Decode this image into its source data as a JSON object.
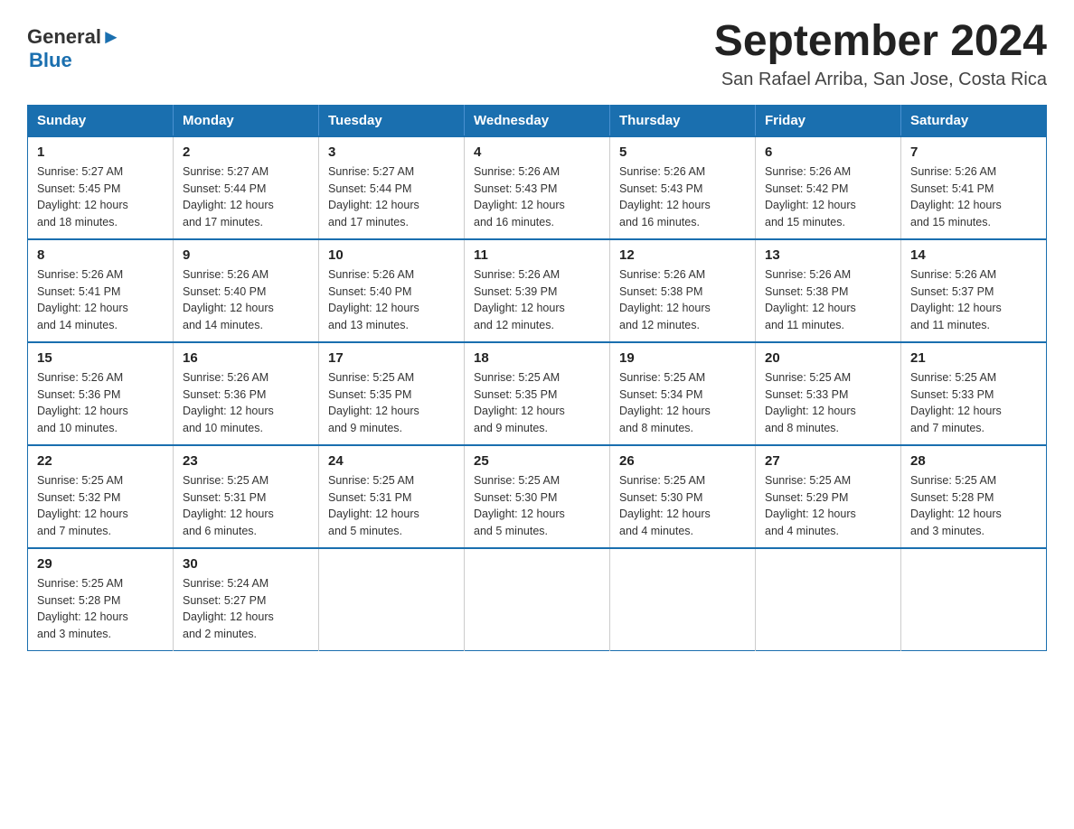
{
  "header": {
    "logo_general": "General",
    "logo_blue": "Blue",
    "month_title": "September 2024",
    "subtitle": "San Rafael Arriba, San Jose, Costa Rica"
  },
  "days_of_week": [
    "Sunday",
    "Monday",
    "Tuesday",
    "Wednesday",
    "Thursday",
    "Friday",
    "Saturday"
  ],
  "weeks": [
    [
      {
        "day": "1",
        "sunrise": "5:27 AM",
        "sunset": "5:45 PM",
        "daylight": "12 hours and 18 minutes."
      },
      {
        "day": "2",
        "sunrise": "5:27 AM",
        "sunset": "5:44 PM",
        "daylight": "12 hours and 17 minutes."
      },
      {
        "day": "3",
        "sunrise": "5:27 AM",
        "sunset": "5:44 PM",
        "daylight": "12 hours and 17 minutes."
      },
      {
        "day": "4",
        "sunrise": "5:26 AM",
        "sunset": "5:43 PM",
        "daylight": "12 hours and 16 minutes."
      },
      {
        "day": "5",
        "sunrise": "5:26 AM",
        "sunset": "5:43 PM",
        "daylight": "12 hours and 16 minutes."
      },
      {
        "day": "6",
        "sunrise": "5:26 AM",
        "sunset": "5:42 PM",
        "daylight": "12 hours and 15 minutes."
      },
      {
        "day": "7",
        "sunrise": "5:26 AM",
        "sunset": "5:41 PM",
        "daylight": "12 hours and 15 minutes."
      }
    ],
    [
      {
        "day": "8",
        "sunrise": "5:26 AM",
        "sunset": "5:41 PM",
        "daylight": "12 hours and 14 minutes."
      },
      {
        "day": "9",
        "sunrise": "5:26 AM",
        "sunset": "5:40 PM",
        "daylight": "12 hours and 14 minutes."
      },
      {
        "day": "10",
        "sunrise": "5:26 AM",
        "sunset": "5:40 PM",
        "daylight": "12 hours and 13 minutes."
      },
      {
        "day": "11",
        "sunrise": "5:26 AM",
        "sunset": "5:39 PM",
        "daylight": "12 hours and 12 minutes."
      },
      {
        "day": "12",
        "sunrise": "5:26 AM",
        "sunset": "5:38 PM",
        "daylight": "12 hours and 12 minutes."
      },
      {
        "day": "13",
        "sunrise": "5:26 AM",
        "sunset": "5:38 PM",
        "daylight": "12 hours and 11 minutes."
      },
      {
        "day": "14",
        "sunrise": "5:26 AM",
        "sunset": "5:37 PM",
        "daylight": "12 hours and 11 minutes."
      }
    ],
    [
      {
        "day": "15",
        "sunrise": "5:26 AM",
        "sunset": "5:36 PM",
        "daylight": "12 hours and 10 minutes."
      },
      {
        "day": "16",
        "sunrise": "5:26 AM",
        "sunset": "5:36 PM",
        "daylight": "12 hours and 10 minutes."
      },
      {
        "day": "17",
        "sunrise": "5:25 AM",
        "sunset": "5:35 PM",
        "daylight": "12 hours and 9 minutes."
      },
      {
        "day": "18",
        "sunrise": "5:25 AM",
        "sunset": "5:35 PM",
        "daylight": "12 hours and 9 minutes."
      },
      {
        "day": "19",
        "sunrise": "5:25 AM",
        "sunset": "5:34 PM",
        "daylight": "12 hours and 8 minutes."
      },
      {
        "day": "20",
        "sunrise": "5:25 AM",
        "sunset": "5:33 PM",
        "daylight": "12 hours and 8 minutes."
      },
      {
        "day": "21",
        "sunrise": "5:25 AM",
        "sunset": "5:33 PM",
        "daylight": "12 hours and 7 minutes."
      }
    ],
    [
      {
        "day": "22",
        "sunrise": "5:25 AM",
        "sunset": "5:32 PM",
        "daylight": "12 hours and 7 minutes."
      },
      {
        "day": "23",
        "sunrise": "5:25 AM",
        "sunset": "5:31 PM",
        "daylight": "12 hours and 6 minutes."
      },
      {
        "day": "24",
        "sunrise": "5:25 AM",
        "sunset": "5:31 PM",
        "daylight": "12 hours and 5 minutes."
      },
      {
        "day": "25",
        "sunrise": "5:25 AM",
        "sunset": "5:30 PM",
        "daylight": "12 hours and 5 minutes."
      },
      {
        "day": "26",
        "sunrise": "5:25 AM",
        "sunset": "5:30 PM",
        "daylight": "12 hours and 4 minutes."
      },
      {
        "day": "27",
        "sunrise": "5:25 AM",
        "sunset": "5:29 PM",
        "daylight": "12 hours and 4 minutes."
      },
      {
        "day": "28",
        "sunrise": "5:25 AM",
        "sunset": "5:28 PM",
        "daylight": "12 hours and 3 minutes."
      }
    ],
    [
      {
        "day": "29",
        "sunrise": "5:25 AM",
        "sunset": "5:28 PM",
        "daylight": "12 hours and 3 minutes."
      },
      {
        "day": "30",
        "sunrise": "5:24 AM",
        "sunset": "5:27 PM",
        "daylight": "12 hours and 2 minutes."
      },
      null,
      null,
      null,
      null,
      null
    ]
  ],
  "labels": {
    "sunrise": "Sunrise:",
    "sunset": "Sunset:",
    "daylight": "Daylight:"
  }
}
